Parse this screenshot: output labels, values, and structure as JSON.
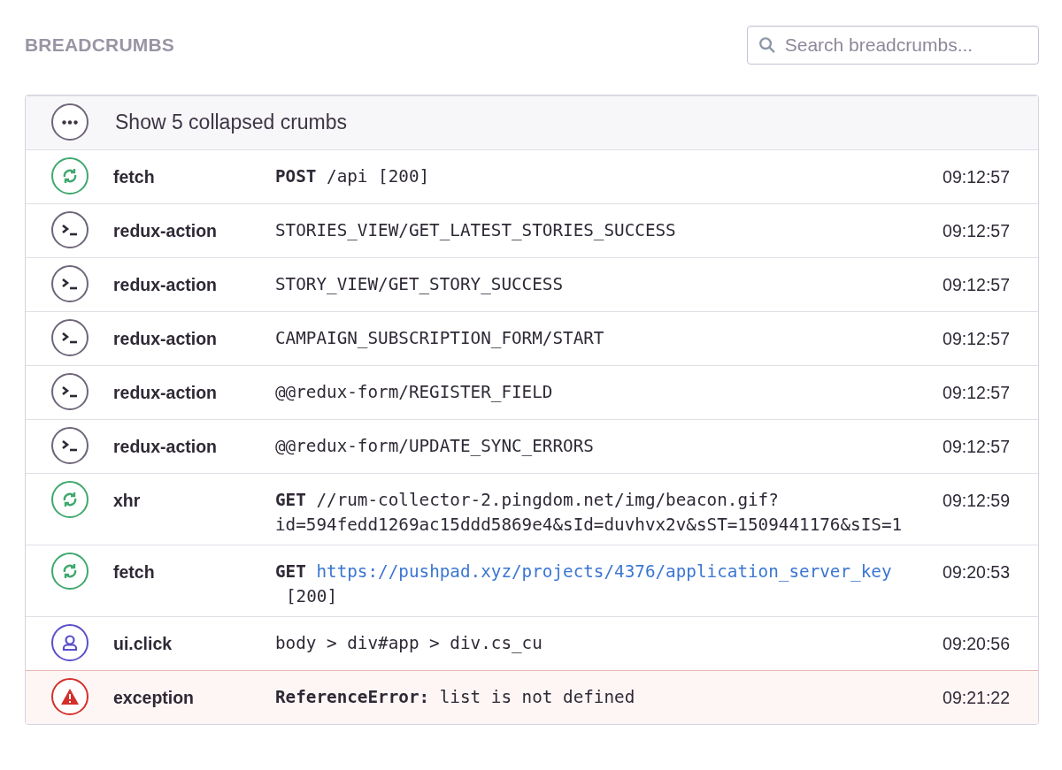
{
  "header": {
    "title": "BREADCRUMBS",
    "search": {
      "placeholder": "Search breadcrumbs..."
    }
  },
  "collapsed": {
    "label": "Show 5 collapsed crumbs"
  },
  "crumbs": [
    {
      "kind": "network",
      "category": "fetch",
      "message_lines": [
        "**POST** /api [200]"
      ],
      "time": "09:12:57"
    },
    {
      "kind": "action",
      "category": "redux-action",
      "message_lines": [
        "STORIES_VIEW/GET_LATEST_STORIES_SUCCESS"
      ],
      "time": "09:12:57"
    },
    {
      "kind": "action",
      "category": "redux-action",
      "message_lines": [
        "STORY_VIEW/GET_STORY_SUCCESS"
      ],
      "time": "09:12:57"
    },
    {
      "kind": "action",
      "category": "redux-action",
      "message_lines": [
        "CAMPAIGN_SUBSCRIPTION_FORM/START"
      ],
      "time": "09:12:57"
    },
    {
      "kind": "action",
      "category": "redux-action",
      "message_lines": [
        "@@redux-form/REGISTER_FIELD"
      ],
      "time": "09:12:57"
    },
    {
      "kind": "action",
      "category": "redux-action",
      "message_lines": [
        "@@redux-form/UPDATE_SYNC_ERRORS"
      ],
      "time": "09:12:57"
    },
    {
      "kind": "network",
      "category": "xhr",
      "message_lines": [
        "**GET** //rum-collector-2.pingdom.net/img/beacon.gif?",
        "id=594fedd1269ac15ddd5869e4&sId=duvhvx2v&sST=1509441176&sIS=1"
      ],
      "time": "09:12:59"
    },
    {
      "kind": "network",
      "category": "fetch",
      "method": "GET",
      "link": "https://pushpad.xyz/projects/4376/application_server_key",
      "message_lines": [
        "[200]"
      ],
      "time": "09:20:53"
    },
    {
      "kind": "user",
      "category": "ui.click",
      "message_lines": [
        "body > div#app > div.cs_cu"
      ],
      "time": "09:20:56"
    },
    {
      "kind": "error",
      "category": "exception",
      "message_lines": [
        "**ReferenceError:** list is not defined"
      ],
      "time": "09:21:22"
    }
  ]
}
